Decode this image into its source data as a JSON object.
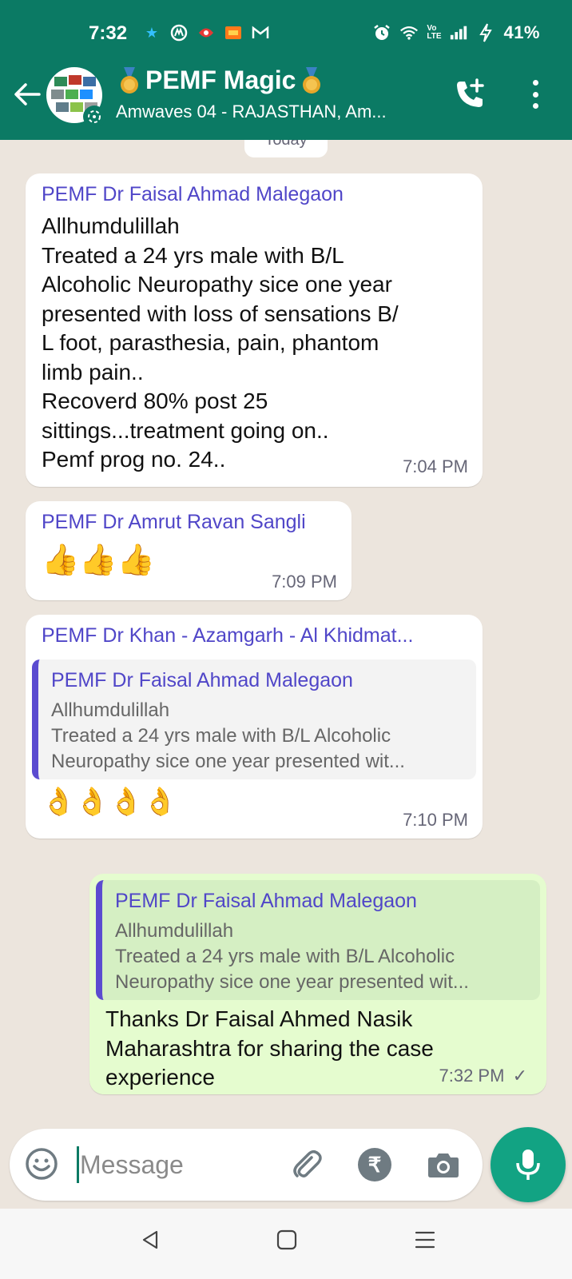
{
  "status_bar": {
    "time": "7:32",
    "battery": "41%",
    "network_label": "Vo LTE"
  },
  "header": {
    "title": "PEMF Magic",
    "subtitle": "Amwaves 04 - RAJASTHAN, Am...",
    "icons": [
      "back-arrow-icon",
      "group-avatar",
      "medal-icon",
      "add-call-icon",
      "overflow-menu-icon"
    ],
    "bar_color": "#0b7a64"
  },
  "date_chip": "Today",
  "messages": [
    {
      "sender": "PEMF Dr Faisal Ahmad Malegaon",
      "lines": [
        "Allhumdulillah",
        "Treated a 24 yrs male with B/L",
        "Alcoholic Neuropathy sice one year",
        "presented with loss of sensations B/",
        "L foot, parasthesia, pain, phantom",
        "limb pain..",
        "Recoverd 80% post 25",
        "sittings...treatment going on..",
        "Pemf prog no. 24.."
      ],
      "time": "7:04 PM"
    },
    {
      "sender": "PEMF Dr Amrut Ravan Sangli",
      "emoji": "👍👍👍",
      "time": "7:09 PM"
    },
    {
      "sender": "PEMF Dr Khan - Azamgarh - Al Khidmat...",
      "quote": {
        "sender": "PEMF Dr Faisal Ahmad Malegaon",
        "line1": "Allhumdulillah",
        "line2": "Treated a 24 yrs male with B/L Alcoholic",
        "line3": "Neuropathy sice one year presented wit..."
      },
      "emoji": "👌👌👌👌",
      "time": "7:10 PM"
    },
    {
      "quote": {
        "sender": "PEMF Dr Faisal Ahmad Malegaon",
        "line1": "Allhumdulillah",
        "line2": "Treated a 24 yrs male with B/L Alcoholic",
        "line3": "Neuropathy sice one year presented wit..."
      },
      "lines": [
        "Thanks Dr Faisal Ahmed Nasik",
        "Maharashtra for sharing the case",
        "experience"
      ],
      "time": "7:32 PM",
      "tick": "✓"
    }
  ],
  "composer": {
    "placeholder": "Message",
    "icons": [
      "emoji-icon",
      "attach-icon",
      "rupee-icon",
      "camera-icon",
      "mic-icon"
    ]
  },
  "colors": {
    "accent": "#0b7a64",
    "sender_name": "#5046c8",
    "outgoing_bubble": "#e5fccf",
    "mic_button": "#12a383"
  }
}
